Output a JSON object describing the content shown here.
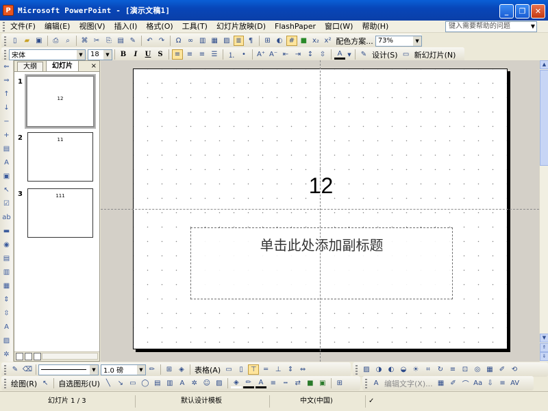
{
  "window": {
    "app_icon_glyph": "P",
    "title": "Microsoft PowerPoint - [演示文稿1]",
    "minimize": "_",
    "restore": "❐",
    "close": "✕"
  },
  "menubar": {
    "items": [
      "文件(F)",
      "编辑(E)",
      "视图(V)",
      "插入(I)",
      "格式(O)",
      "工具(T)",
      "幻灯片放映(D)",
      "FlashPaper",
      "窗口(W)",
      "帮助(H)"
    ],
    "help_placeholder": "键入需要帮助的问题"
  },
  "standard_toolbar": {
    "color_scheme_label": "配色方案...",
    "zoom": "73%"
  },
  "format_toolbar": {
    "font": "宋体",
    "font_size": "18",
    "bold": "B",
    "italic": "I",
    "underline": "U",
    "shadow": "S",
    "design_label": "设计(S)",
    "new_slide_label": "新幻灯片(N)"
  },
  "pane": {
    "tab_outline": "大纲",
    "tab_slides": "幻灯片",
    "close": "×",
    "slides": [
      {
        "number": "1",
        "title": "12"
      },
      {
        "number": "2",
        "title": "11"
      },
      {
        "number": "3",
        "title": "111"
      }
    ]
  },
  "slide": {
    "title": "12",
    "subtitle_placeholder": "单击此处添加副标题"
  },
  "draw_toolbar_top": {
    "line_width": "1.0 磅",
    "table_label": "表格(A)"
  },
  "draw_toolbar_bottom": {
    "draw_label": "绘图(R)",
    "autoshapes_label": "自选图形(U)",
    "edit_text_label": "编辑文字(X)..."
  },
  "statusbar": {
    "slide_info": "幻灯片 1 / 3",
    "template": "默认设计模板",
    "language": "中文(中国)"
  },
  "colors": {
    "titlebar": "#0A5FD6",
    "chrome": "#ECE9D8",
    "edit_area": "#D4D0C8"
  }
}
